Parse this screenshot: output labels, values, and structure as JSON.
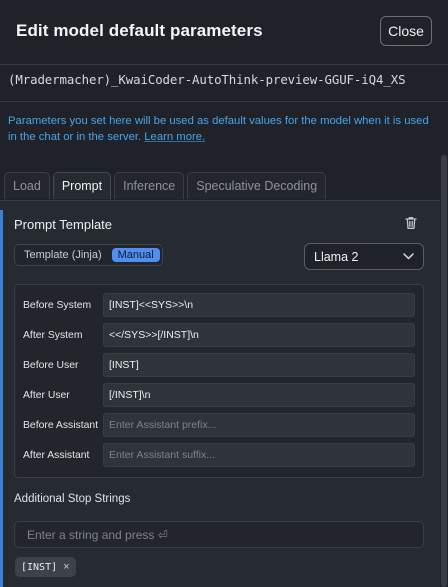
{
  "dialog": {
    "title": "Edit model default parameters",
    "close_label": "Close",
    "model_name": "(Mradermacher)_KwaiCoder-AutoThink-preview-GGUF-iQ4_XS",
    "description": "Parameters you set here will be used as default values for the model when it is used in the chat or in the server.",
    "learn_more": "Learn more."
  },
  "tabs": [
    {
      "label": "Load",
      "active": false
    },
    {
      "label": "Prompt",
      "active": true
    },
    {
      "label": "Inference",
      "active": false
    },
    {
      "label": "Speculative Decoding",
      "active": false
    }
  ],
  "prompt_template": {
    "section_title": "Prompt Template",
    "mode_label": "Template (Jinja)",
    "mode_value": "Manual",
    "preset": "Llama 2",
    "fields": [
      {
        "label": "Before System",
        "value": "[INST]<<SYS>>\\n",
        "placeholder": ""
      },
      {
        "label": "After System",
        "value": "<</SYS>>[/INST]\\n",
        "placeholder": ""
      },
      {
        "label": "Before User",
        "value": "[INST]",
        "placeholder": ""
      },
      {
        "label": "After User",
        "value": "[/INST]\\n",
        "placeholder": ""
      },
      {
        "label": "Before Assistant",
        "value": "",
        "placeholder": "Enter Assistant prefix..."
      },
      {
        "label": "After Assistant",
        "value": "",
        "placeholder": "Enter Assistant suffix..."
      }
    ]
  },
  "stop_strings": {
    "title": "Additional Stop Strings",
    "placeholder": "Enter a string and press ⏎",
    "chips": [
      "[INST]"
    ],
    "chip_remove": "×"
  },
  "colors": {
    "background": "#1f2329",
    "panel": "#262a31",
    "accent": "#3b82d6",
    "link": "#4aa3e8",
    "manual_badge": "#4f8ff0"
  },
  "icons": {
    "delete": "trash-icon",
    "select": "chevron-down-icon",
    "remove_chip": "close-icon"
  }
}
